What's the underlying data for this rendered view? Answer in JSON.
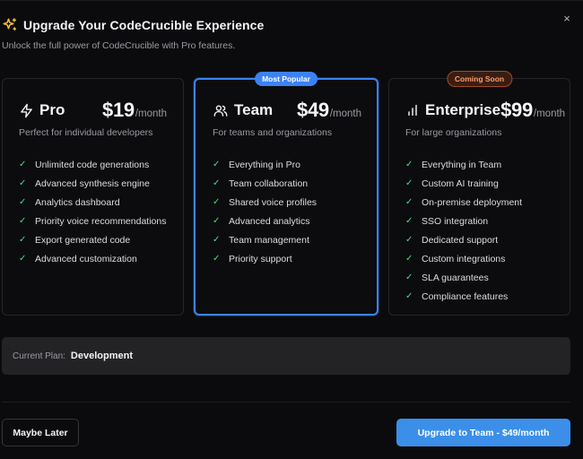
{
  "header": {
    "title": "Upgrade Your CodeCrucible Experience",
    "subtitle": "Unlock the full power of CodeCrucible with Pro features.",
    "icon": "sparkles-icon",
    "accent_color": "#f5b93a"
  },
  "close_label": "×",
  "plans": [
    {
      "name": "Pro",
      "icon": "lightning-icon",
      "price": "$19",
      "period": "/month",
      "description": "Perfect for individual developers",
      "features": [
        "Unlimited code generations",
        "Advanced synthesis engine",
        "Analytics dashboard",
        "Priority voice recommendations",
        "Export generated code",
        "Advanced customization"
      ]
    },
    {
      "name": "Team",
      "icon": "users-icon",
      "price": "$49",
      "period": "/month",
      "description": "For teams and organizations",
      "badge": "Most Popular",
      "features": [
        "Everything in Pro",
        "Team collaboration",
        "Shared voice profiles",
        "Advanced analytics",
        "Team management",
        "Priority support"
      ]
    },
    {
      "name": "Enterprise",
      "icon": "bar-chart-icon",
      "price": "$99",
      "period": "/month",
      "description": "For large organizations",
      "badge": "Coming Soon",
      "features": [
        "Everything in Team",
        "Custom AI training",
        "On-premise deployment",
        "SSO integration",
        "Dedicated support",
        "Custom integrations",
        "SLA guarantees",
        "Compliance features"
      ]
    }
  ],
  "current_plan": {
    "label": "Current Plan:",
    "value": "Development"
  },
  "footer": {
    "secondary_label": "Maybe Later",
    "primary_label": "Upgrade to Team - $49/month"
  },
  "colors": {
    "primary": "#3b82f6",
    "check": "#4ade80",
    "coming_soon": "#f59e6b"
  }
}
